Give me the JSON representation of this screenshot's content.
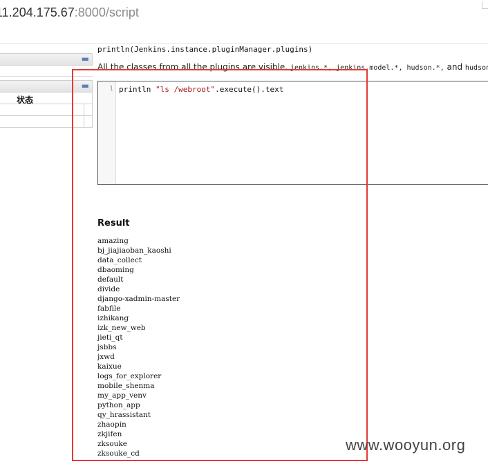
{
  "address_bar": {
    "host": "11.204.175.67",
    "rest": ":8000/script"
  },
  "sidebar": {
    "status_column_label": "状态",
    "collapse_glyph": "▬"
  },
  "script_console": {
    "example_code": "println(Jenkins.instance.pluginManager.plugins)",
    "description_prefix": "All the classes from all the plugins are visible.",
    "description_packages": "jenkins.*, jenkins.model.*, hudson.*,",
    "description_and": "and",
    "description_suffix": "hudson.mo",
    "editor": {
      "line_number": "1",
      "code_keyword": "println",
      "code_string": "\"ls /webroot\"",
      "code_rest": ".execute().text"
    },
    "result_heading": "Result",
    "result_lines": [
      "amazing",
      "bj_jiajiaoban_kaoshi",
      "data_collect",
      "dbaoming",
      "default",
      "divide",
      "django-xadmin-master",
      "fabfile",
      "izhikang",
      "izk_new_web",
      "jieti_qt",
      "jsbbs",
      "jxwd",
      "kaixue",
      "logs_for_explorer",
      "mobile_shenma",
      "my_app_venv",
      "python_app",
      "qy_hrassistant",
      "zhaopin",
      "zkjifen",
      "zksouke",
      "zksouke_cd"
    ]
  },
  "watermark": "www.wooyun.org",
  "colors": {
    "highlight_box": "#e53935"
  }
}
